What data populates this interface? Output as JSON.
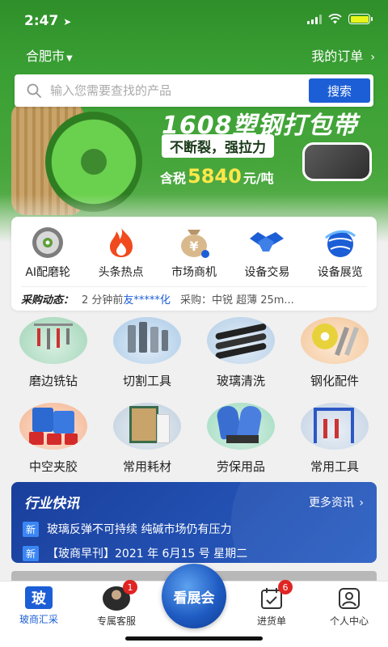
{
  "status_bar": {
    "time": "2:47"
  },
  "header": {
    "city": "合肥市",
    "orders": "我的订单"
  },
  "search": {
    "placeholder": "输入您需要查找的产品",
    "button": "搜索"
  },
  "banner": {
    "title": "1608塑钢打包带",
    "slogan": "不断裂，强拉力",
    "price_prefix": "含税",
    "price_value": "5840",
    "price_unit": "元/吨"
  },
  "quick_nav": [
    {
      "label": "AI配磨轮",
      "icon": "grinding-wheel-icon"
    },
    {
      "label": "头条热点",
      "icon": "flame-icon"
    },
    {
      "label": "市场商机",
      "icon": "money-bag-icon"
    },
    {
      "label": "设备交易",
      "icon": "handshake-icon"
    },
    {
      "label": "设备展览",
      "icon": "globe-icon"
    }
  ],
  "purchase_ticker": {
    "tag": "采购动态：",
    "time": "2 分钟前",
    "user": "友*****化",
    "content": "采购：中锐 超薄 25m..."
  },
  "categories": [
    {
      "label": "磨边铣钻",
      "icon": "edging-drill-icon"
    },
    {
      "label": "切割工具",
      "icon": "cutting-tool-icon"
    },
    {
      "label": "玻璃清洗",
      "icon": "glass-cleaning-icon"
    },
    {
      "label": "钢化配件",
      "icon": "tempering-parts-icon"
    },
    {
      "label": "中空夹胶",
      "icon": "insulating-glue-icon"
    },
    {
      "label": "常用耗材",
      "icon": "consumables-icon"
    },
    {
      "label": "劳保用品",
      "icon": "safety-gloves-icon"
    },
    {
      "label": "常用工具",
      "icon": "tools-rack-icon"
    }
  ],
  "industry_news": {
    "title": "行业快讯",
    "more": "更多资讯",
    "items": [
      {
        "badge": "新",
        "text": "玻璃反弹不可持续 纯碱市场仍有压力"
      },
      {
        "badge": "新",
        "text": "【玻商早刊】2021 年 6月15 号 星期二"
      }
    ]
  },
  "tabbar": {
    "tabs": [
      {
        "label": "玻商汇采",
        "icon": "bo-logo-icon"
      },
      {
        "label": "专属客服",
        "icon": "agent-avatar-icon",
        "badge": "1"
      },
      {
        "label": "看展会",
        "icon": "expo-globe-icon"
      },
      {
        "label": "进货单",
        "icon": "purchase-list-icon",
        "badge": "6"
      },
      {
        "label": "个人中心",
        "icon": "user-profile-icon"
      }
    ]
  },
  "colors": {
    "brand_blue": "#1c5ed6",
    "hero_green": "#3aa034",
    "news_blue": "#1a3f9c",
    "badge_red": "#e02424"
  }
}
